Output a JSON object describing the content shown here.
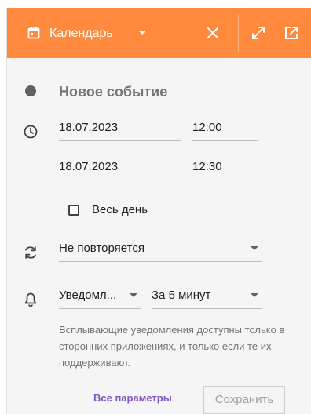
{
  "header": {
    "title": "Календарь",
    "icons": [
      "calendar-icon",
      "chevron-down-icon",
      "close-icon",
      "expand-icon",
      "open-external-icon"
    ],
    "accent": "#ff8a3d"
  },
  "event": {
    "title": "Новое событие",
    "color": "#616161"
  },
  "when": {
    "start_date": "18.07.2023",
    "start_time": "12:00",
    "end_date": "18.07.2023",
    "end_time": "12:30",
    "all_day_label": "Весь день",
    "all_day_checked": false
  },
  "repeat": {
    "value": "Не повторяется"
  },
  "reminder": {
    "type": "Уведомл...",
    "time": "За 5 минут",
    "note": "Всплывающие уведомления доступны только в сторонних приложениях, и только если те их поддерживают."
  },
  "footer": {
    "all_params": "Все параметры",
    "save": "Сохранить"
  }
}
